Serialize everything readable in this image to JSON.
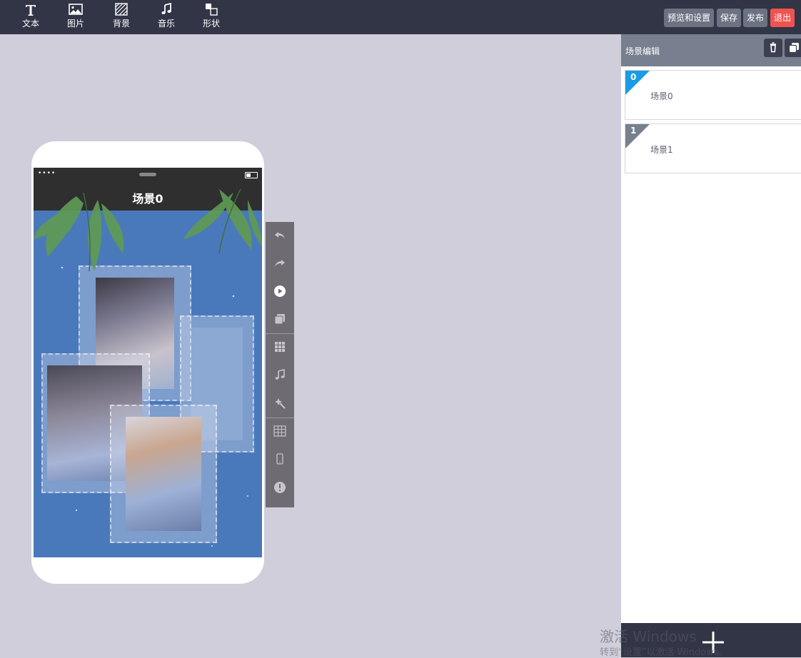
{
  "toolbar": {
    "text_label": "文本",
    "image_label": "图片",
    "background_label": "背景",
    "music_label": "音乐",
    "shape_label": "形状",
    "preview_label": "预览和设置",
    "save_label": "保存",
    "publish_label": "发布",
    "exit_label": "退出"
  },
  "phone": {
    "status_dots": "••••",
    "scene_title": "场景0"
  },
  "right_panel": {
    "title": "场景编辑",
    "scenes": [
      {
        "num": "0",
        "name": "场景0",
        "color": "#1a9be6"
      },
      {
        "num": "1",
        "name": "场景1",
        "color": "#787f8e"
      }
    ]
  },
  "watermark": {
    "line1": "激活 Windows",
    "line2": "转到“设置”以激活 Windows。"
  },
  "colors": {
    "topbar": "#323546",
    "canvas": "#d0cedb",
    "exit": "#ef5350",
    "active_scene": "#1a9be6"
  }
}
